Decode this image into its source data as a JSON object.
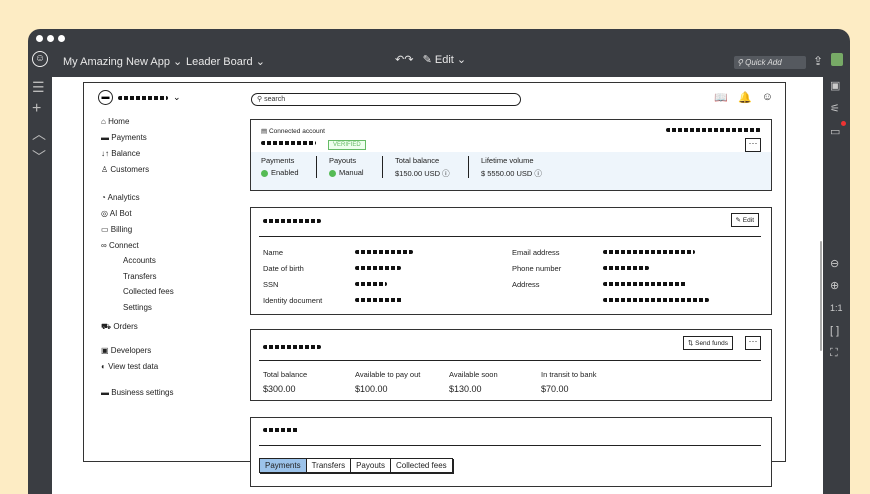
{
  "topbar": {
    "app_title": "My Amazing New App",
    "board": "Leader Board",
    "edit": "Edit",
    "quick_add": "Quick Add"
  },
  "header": {
    "search_placeholder": "search"
  },
  "nav": {
    "home": "Home",
    "payments": "Payments",
    "balance": "Balance",
    "customers": "Customers",
    "analytics": "Analytics",
    "ai_bot": "AI Bot",
    "billing": "Billing",
    "connect": "Connect",
    "accounts": "Accounts",
    "transfers": "Transfers",
    "collected_fees": "Collected fees",
    "settings": "Settings",
    "orders": "Orders",
    "developers": "Developers",
    "view_test_data": "View test data",
    "business_settings": "Business settings"
  },
  "account": {
    "label": "Connected account",
    "status": "VERIFIED",
    "payments_label": "Payments",
    "payments_value": "Enabled",
    "payouts_label": "Payouts",
    "payouts_value": "Manual",
    "total_balance_label": "Total balance",
    "total_balance_value": "$150.00 USD",
    "lifetime_label": "Lifetime volume",
    "lifetime_value": "$ 5550.00 USD"
  },
  "profile": {
    "edit": "Edit",
    "name": "Name",
    "dob": "Date of birth",
    "ssn": "SSN",
    "id_doc": "Identity document",
    "email": "Email address",
    "phone": "Phone number",
    "address": "Address"
  },
  "balance": {
    "send_funds": "Send funds",
    "total_label": "Total balance",
    "total_value": "$300.00",
    "available_label": "Available to pay out",
    "available_value": "$100.00",
    "soon_label": "Available soon",
    "soon_value": "$130.00",
    "transit_label": "In transit to bank",
    "transit_value": "$70.00"
  },
  "tabs": {
    "payments": "Payments",
    "transfers": "Transfers",
    "payouts": "Payouts",
    "collected_fees": "Collected fees"
  }
}
